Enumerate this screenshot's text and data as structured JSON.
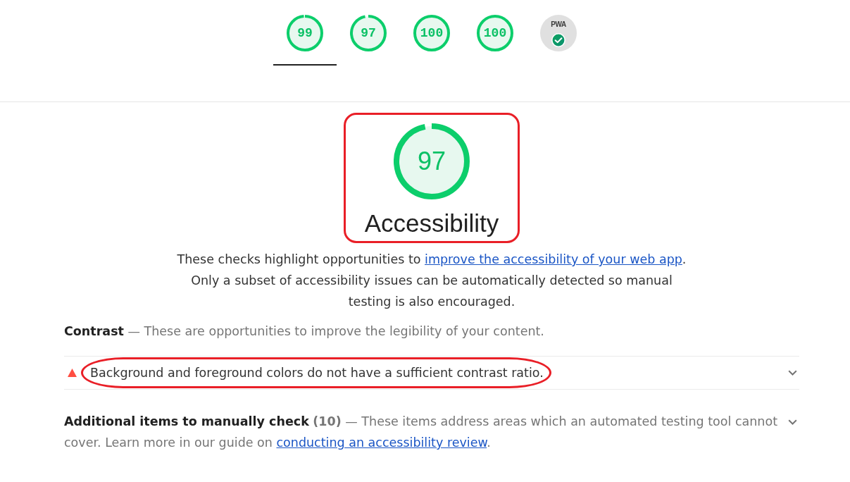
{
  "header_gauges": [
    {
      "kind": "score",
      "score": "99",
      "level": 0.99,
      "selected": true
    },
    {
      "kind": "score",
      "score": "97",
      "level": 0.97,
      "selected": false
    },
    {
      "kind": "score",
      "score": "100",
      "level": 1,
      "selected": false
    },
    {
      "kind": "score",
      "score": "100",
      "level": 1,
      "selected": false
    },
    {
      "kind": "pwa",
      "label": "PWA",
      "selected": false
    }
  ],
  "category": {
    "score": "97",
    "level": 0.97,
    "title": "Accessibility",
    "highlighted": true,
    "description": {
      "before": "These checks highlight opportunities to ",
      "link": "improve the accessibility of your web app",
      "after": ". Only a subset of accessibility issues can be automatically detected so manual testing is also encouraged."
    }
  },
  "groups": [
    {
      "title": "Contrast",
      "description": "— These are opportunities to improve the legibility of your content.",
      "audits": [
        {
          "kind": "fail",
          "title": "Background and foreground colors do not have a sufficient contrast ratio.",
          "highlighted": true,
          "expanded": false
        }
      ]
    }
  ],
  "manual_checks": {
    "title": "Additional items to manually check",
    "count": "(10)",
    "description": "— These items address areas which an automated testing tool cannot cover. Learn more in our guide on ",
    "link": "conducting an accessibility review",
    "after": ".",
    "expanded": false
  }
}
